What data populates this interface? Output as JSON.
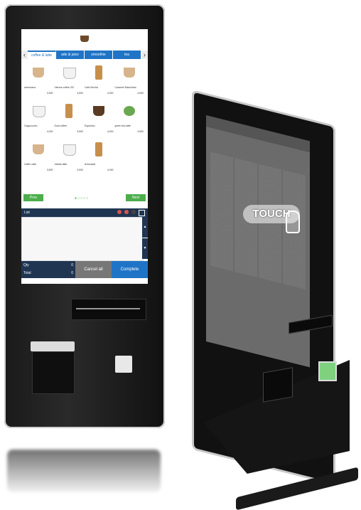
{
  "left_kiosk": {
    "logo_text": "",
    "tabs": [
      "coffee & latte",
      "ade & juice",
      "smoothie",
      "tea"
    ],
    "items": [
      {
        "name": "americano",
        "price": "2,500"
      },
      {
        "name": "Vienna coffee OD",
        "price": "4,500"
      },
      {
        "name": "Cafe Mocha",
        "price": "4,000"
      },
      {
        "name": "Caramel Macchiato",
        "price": "4,500"
      },
      {
        "name": "Cappuccino",
        "price": "4,000"
      },
      {
        "name": "Dual coffee",
        "price": "3,500"
      },
      {
        "name": "Espresso",
        "price": "4,000"
      },
      {
        "name": "green tea latte",
        "price": "4,500"
      },
      {
        "name": "Caffe Latte",
        "price": "3,500"
      },
      {
        "name": "Vanilla latte",
        "price": "3,500"
      },
      {
        "name": "lemonade",
        "price": "4,000"
      }
    ],
    "prev_label": "Prev",
    "next_label": "Next",
    "list_label": "List",
    "list_empty_text": "",
    "qty_label": "Qty",
    "qty_value": "0",
    "total_label": "Total",
    "total_value": "0",
    "cancel_label": "Cancel all",
    "complete_label": "Complete"
  },
  "right_kiosk": {
    "touch_label": "TOUCH"
  }
}
